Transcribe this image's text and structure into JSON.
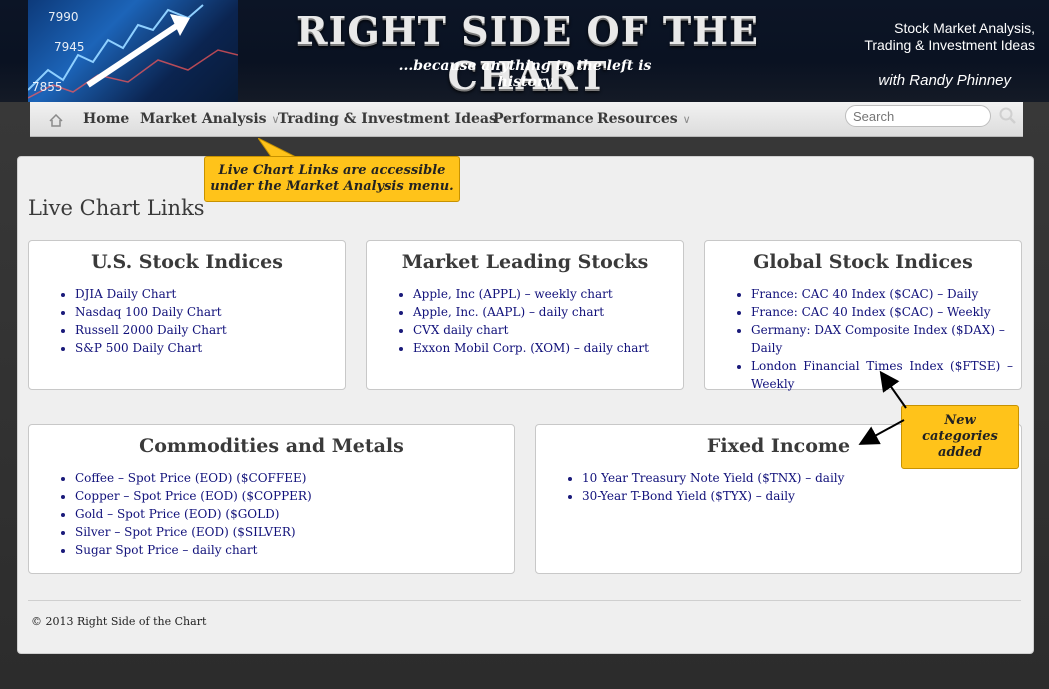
{
  "header": {
    "title": "Right Side of the Chart",
    "tagline": "...because anything to the left is history",
    "right_line1": "Stock Market Analysis,",
    "right_line2": "Trading & Investment Ideas",
    "author": "with Randy Phinney",
    "logo_numbers": [
      "7990",
      "7945",
      "7855"
    ]
  },
  "nav": {
    "items": [
      {
        "label": "Home",
        "icon": "home-icon"
      },
      {
        "label": "Market Analysis",
        "has_dropdown": true
      },
      {
        "label": "Trading & Investment Ideas",
        "has_dropdown": true
      },
      {
        "label": "Performance"
      },
      {
        "label": "Resources",
        "has_dropdown": true
      }
    ],
    "search_placeholder": "Search"
  },
  "callouts": {
    "menu_note": "Live Chart Links are accessible under the Market Analysis menu.",
    "new_categories": "New\ncategories\nadded"
  },
  "page": {
    "title": "Live Chart Links"
  },
  "cards": {
    "us": {
      "title": "U.S. Stock Indices",
      "links": [
        "DJIA Daily Chart",
        "Nasdaq 100 Daily Chart",
        "Russell 2000 Daily Chart",
        "S&P 500 Daily Chart"
      ]
    },
    "leading": {
      "title": "Market Leading Stocks",
      "links": [
        "Apple, Inc (APPL) – weekly chart",
        "Apple, Inc. (AAPL) – daily chart",
        "CVX daily chart",
        "Exxon Mobil Corp. (XOM) – daily chart"
      ]
    },
    "global": {
      "title": "Global Stock Indices",
      "links": [
        "France: CAC 40 Index ($CAC) – Daily",
        "France: CAC 40 Index ($CAC) – Weekly",
        "Germany: DAX Composite Index ($DAX) – Daily",
        "London Financial Times Index ($FTSE) – Weekly"
      ]
    },
    "commodities": {
      "title": "Commodities and Metals",
      "links": [
        "Coffee – Spot Price (EOD) ($COFFEE)",
        "Copper – Spot Price (EOD) ($COPPER)",
        "Gold – Spot Price (EOD) ($GOLD)",
        "Silver – Spot Price (EOD) ($SILVER)",
        "Sugar Spot Price – daily chart"
      ]
    },
    "fixed": {
      "title": "Fixed Income",
      "links": [
        "10 Year Treasury Note Yield ($TNX) – daily",
        "30-Year T-Bond Yield ($TYX) – daily"
      ]
    }
  },
  "footer": {
    "copyright": "© 2013 Right Side of the Chart"
  },
  "colors": {
    "callout": "#ffc31a",
    "link": "#10107a",
    "header_bg": "#0c1526"
  }
}
